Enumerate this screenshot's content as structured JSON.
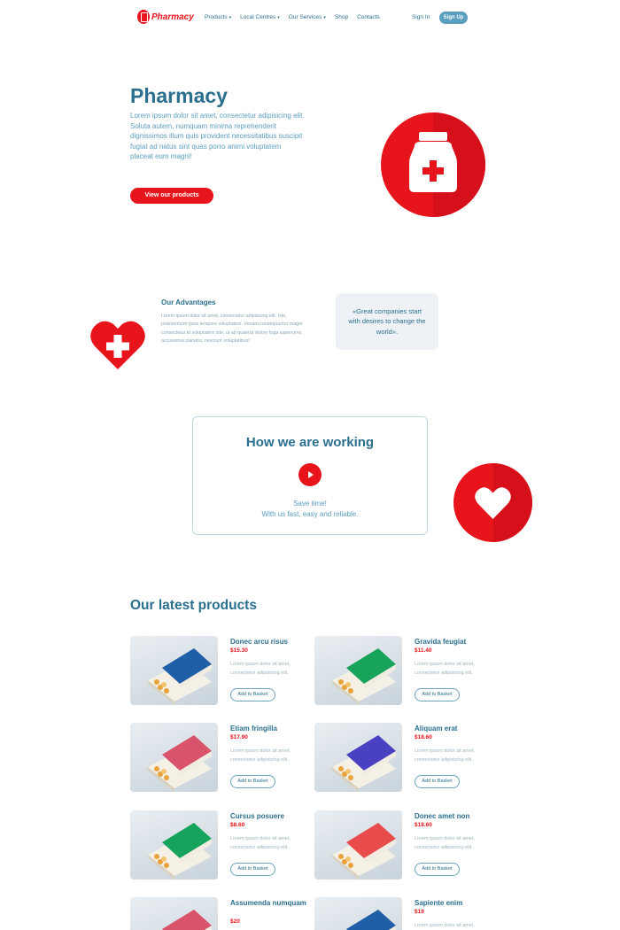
{
  "nav": {
    "logo_text": "Pharmacy",
    "menu": [
      "Products",
      "Local Centres",
      "Our Services",
      "Shop",
      "Contacts"
    ],
    "menu_dropdown": [
      true,
      true,
      true,
      false,
      false
    ],
    "sign_in": "Sign In",
    "sign_up": "Sign Up"
  },
  "hero": {
    "title": "Pharmacy",
    "text": "Lorem ipsum dolor sit amet, consectetur adipisicing elit. Soluta autem, numquam minima reprehenderit dignissimos illum quis provident necessitatibus suscipit fugiat ad natus sint quas porro animi voluptatem placeat eum magni!",
    "button": "View our products",
    "icon": "medicine-bottle-icon"
  },
  "advantages": {
    "title": "Our Advantages",
    "text": "Lorem ipsum dolor sit amet, consectetur adipisicing elit. Iste, praesentium quos tempore voluptatem. Venam consequuntur magni consectetur id voluptatem iste, ut ab quaerat dolore fuga asperiores accusamus pariatur, nesciunt voluptatibus!",
    "quote": "«Great companies start with desires to change the world».",
    "icon": "heart-cross-icon"
  },
  "how": {
    "title": "How we are working",
    "line1": "Save time!",
    "line2": "With us fast, easy and reliable.",
    "play_icon": "play-icon",
    "side_icon": "heart-icon"
  },
  "products": {
    "title": "Our latest products",
    "add_label": "Add to Basket",
    "desc": "Lorem ipsum dolor sit amet, consectetur adipisicing elit.",
    "items": [
      {
        "name": "Donec arcu risus",
        "price": "$15.30",
        "color": "#1f5fa8"
      },
      {
        "name": "Gravida feugiat",
        "price": "$11.40",
        "color": "#17a35a"
      },
      {
        "name": "Etiam fringilla",
        "price": "$17.90",
        "color": "#d9536b"
      },
      {
        "name": "Aliquam erat",
        "price": "$18.60",
        "color": "#4a40c2"
      },
      {
        "name": "Cursus posuere",
        "price": "$8.60",
        "color": "#16a35c"
      },
      {
        "name": "Donec amet non",
        "price": "$18.60",
        "color": "#e84b4b"
      },
      {
        "name": "Assumenda numquam",
        "price": "$20",
        "color": "#d9536b"
      },
      {
        "name": "Sapiente enim",
        "price": "$19",
        "color": "#1f5fa8"
      }
    ]
  },
  "colors": {
    "accent": "#e8141b",
    "primary_text": "#2a6f8e",
    "muted_text": "#5a9ec0"
  }
}
